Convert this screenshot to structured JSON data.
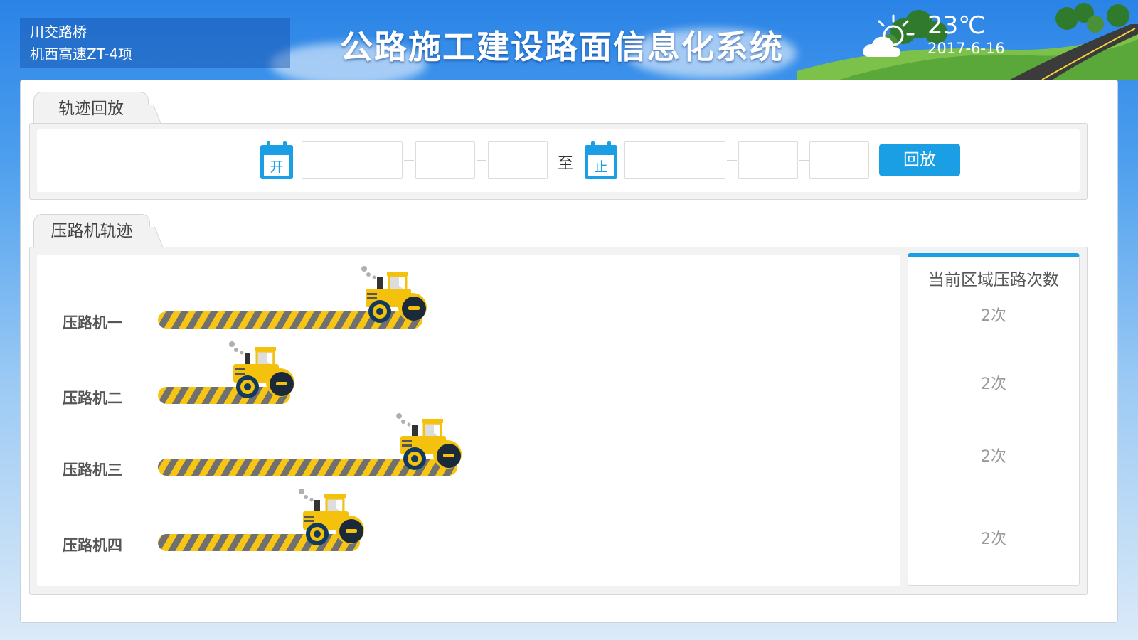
{
  "header": {
    "org_line1": "川交路桥",
    "org_line2": "机西高速ZT-4项",
    "title": "公路施工建设路面信息化系统",
    "weather": {
      "temperature": "23℃",
      "date": "2017-6-16",
      "icon": "partly-cloudy-icon"
    }
  },
  "playback": {
    "tab_label": "轨迹回放",
    "start_icon_label": "开",
    "end_icon_label": "止",
    "start_date": "",
    "start_hour": "",
    "start_minute": "",
    "to_label": "至",
    "end_date": "",
    "end_hour": "",
    "end_minute": "",
    "button_label": "回放"
  },
  "tracks": {
    "tab_label": "压路机轨迹",
    "rollers": [
      {
        "name": "压路机一",
        "progress": 0.38
      },
      {
        "name": "压路机二",
        "progress": 0.19
      },
      {
        "name": "压路机三",
        "progress": 0.43
      },
      {
        "name": "压路机四",
        "progress": 0.29
      }
    ]
  },
  "counts": {
    "title": "当前区域压路次数",
    "values": [
      "2次",
      "2次",
      "2次",
      "2次"
    ]
  },
  "colors": {
    "accent": "#1a9ee4",
    "stripe_yellow": "#f7c514",
    "stripe_gray": "#707070"
  }
}
